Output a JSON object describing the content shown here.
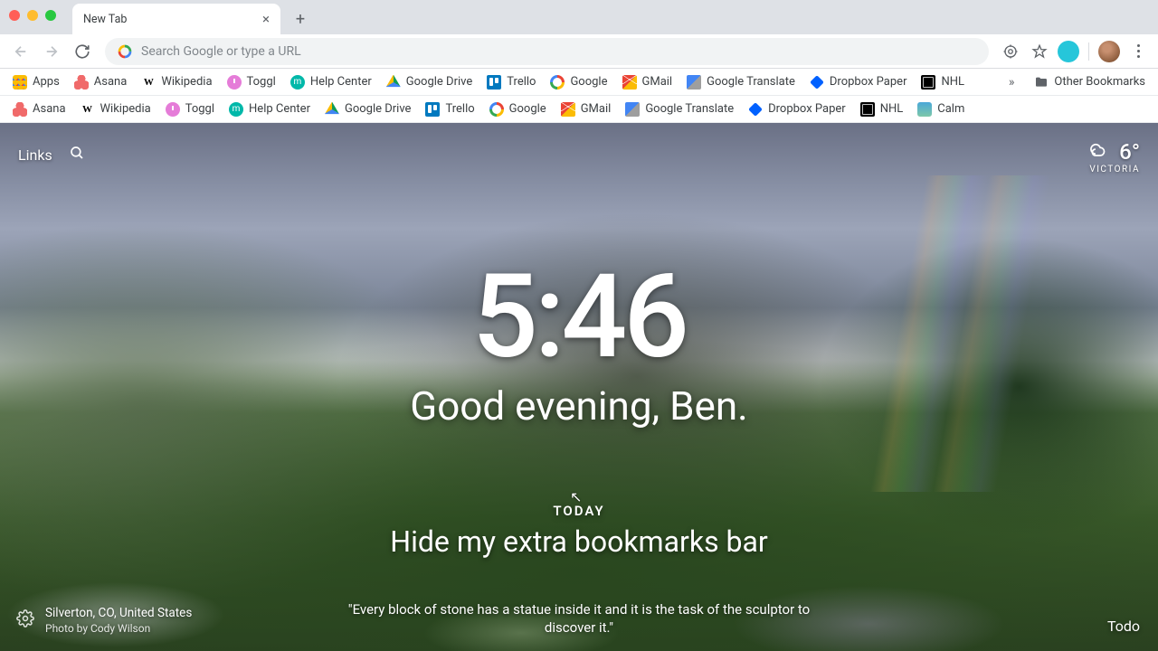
{
  "window": {
    "tab_title": "New Tab"
  },
  "toolbar": {
    "search_placeholder": "Search Google or type a URL"
  },
  "bookmarks_bar_1": {
    "items": [
      {
        "label": "Apps"
      },
      {
        "label": "Asana"
      },
      {
        "label": "Wikipedia"
      },
      {
        "label": "Toggl"
      },
      {
        "label": "Help Center"
      },
      {
        "label": "Google Drive"
      },
      {
        "label": "Trello"
      },
      {
        "label": "Google"
      },
      {
        "label": "GMail"
      },
      {
        "label": "Google Translate"
      },
      {
        "label": "Dropbox Paper"
      },
      {
        "label": "NHL"
      }
    ],
    "other_label": "Other Bookmarks"
  },
  "bookmarks_bar_2": {
    "items": [
      {
        "label": "Asana"
      },
      {
        "label": "Wikipedia"
      },
      {
        "label": "Toggl"
      },
      {
        "label": "Help Center"
      },
      {
        "label": "Google Drive"
      },
      {
        "label": "Trello"
      },
      {
        "label": "Google"
      },
      {
        "label": "GMail"
      },
      {
        "label": "Google Translate"
      },
      {
        "label": "Dropbox Paper"
      },
      {
        "label": "NHL"
      },
      {
        "label": "Calm"
      }
    ]
  },
  "dashboard": {
    "links_label": "Links",
    "weather_temp": "6°",
    "weather_location": "VICTORIA",
    "clock": "5:46",
    "greeting": "Good evening, Ben.",
    "today_label": "TODAY",
    "focus": "Hide my extra bookmarks bar",
    "quote": "\"Every block of stone has a statue inside it and it is the task of the sculptor to discover it.\"",
    "photo_location": "Silverton, CO, United States",
    "photo_credit": "Photo by Cody Wilson",
    "todo_label": "Todo"
  }
}
